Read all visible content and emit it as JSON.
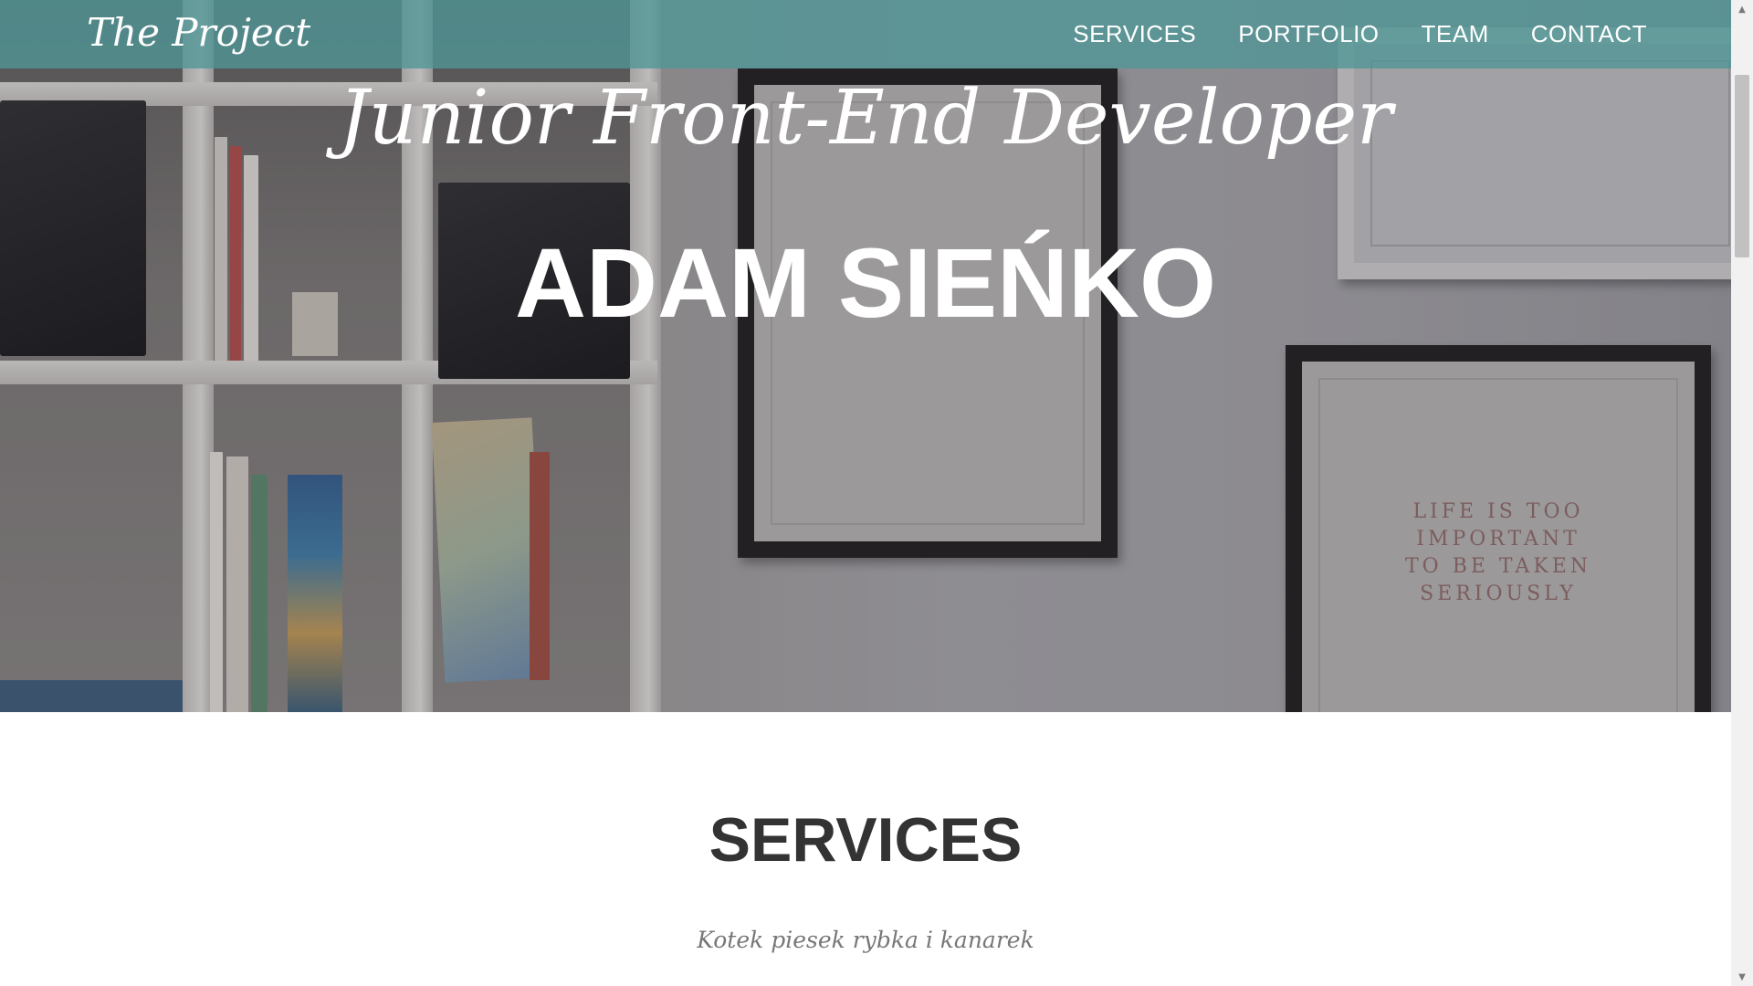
{
  "navbar": {
    "brand": "The Project",
    "links": [
      "SERVICES",
      "PORTFOLIO",
      "TEAM",
      "CONTACT"
    ]
  },
  "hero": {
    "subtitle": "Junior Front-End Developer",
    "name": "ADAM SIEŃKO",
    "poster_text": "LIFE IS TOO\nIMPORTANT\nTO BE TAKEN\nSERIOUSLY"
  },
  "services": {
    "heading": "SERVICES",
    "subheading": "Kotek piesek rybka i kanarek"
  },
  "scrollbar": {
    "up_icon": "▲",
    "down_icon": "▼"
  },
  "colors": {
    "navbar": "#5096968c",
    "heading": "#333333",
    "muted": "#777777"
  }
}
